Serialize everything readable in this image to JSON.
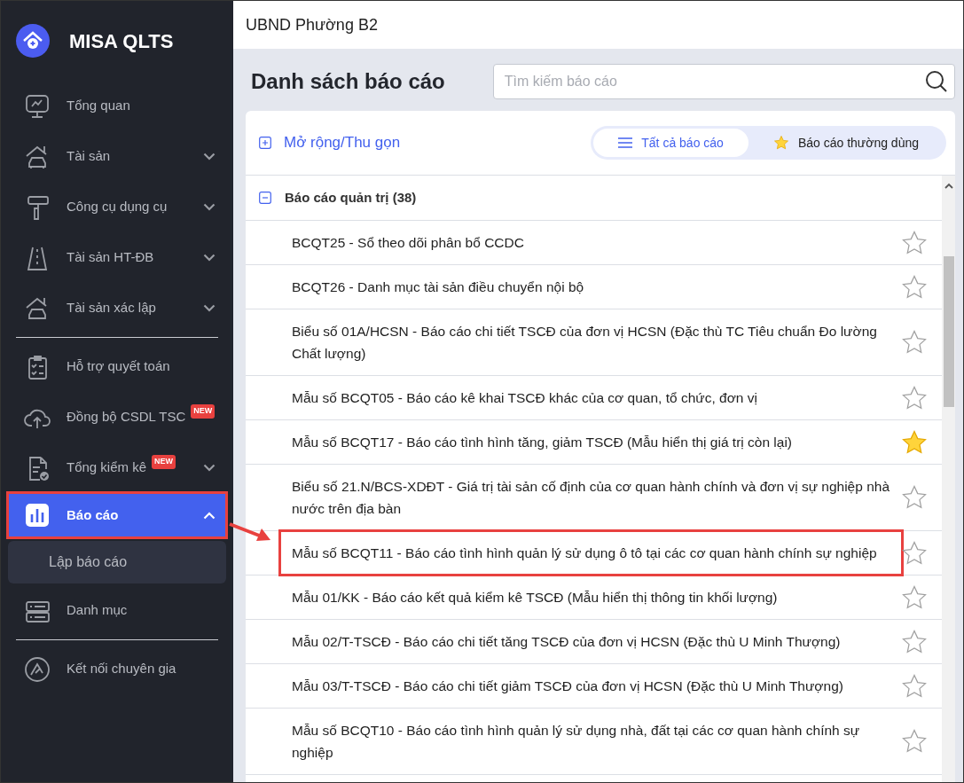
{
  "app": {
    "name": "MISA QLTS"
  },
  "sidebar": {
    "groups": [
      [
        {
          "label": "Tổng quan",
          "selected": false
        },
        {
          "label": "Tài sản",
          "selected": false,
          "expanded": false
        },
        {
          "label": "Công cụ dụng cụ",
          "selected": false,
          "expanded": false
        },
        {
          "label": "Tài sản HT-ĐB",
          "selected": false,
          "expanded": false
        },
        {
          "label": "Tài sản xác lập",
          "selected": false,
          "expanded": false
        }
      ],
      [
        {
          "label": "Hỗ trợ quyết toán",
          "selected": false
        },
        {
          "label": "Đồng bộ CSDL TSC",
          "badge": "NEW",
          "selected": false
        },
        {
          "label": "Tổng kiểm kê",
          "badge": "NEW",
          "selected": false,
          "expanded": false
        },
        {
          "label": "Báo cáo",
          "selected": true,
          "expanded": true,
          "highlighted": true,
          "children": [
            {
              "label": "Lập báo cáo",
              "selected": true
            }
          ]
        },
        {
          "label": "Danh mục",
          "selected": false
        }
      ],
      [
        {
          "label": "Kết nối chuyên gia",
          "selected": false
        }
      ]
    ]
  },
  "header": {
    "title": "UBND Phường B2"
  },
  "page": {
    "title": "Danh sách báo cáo",
    "search": {
      "placeholder": "Tìm kiếm báo cáo"
    }
  },
  "toolbar": {
    "expand_toggle": "Mở rộng/Thu gọn",
    "view_tabs": [
      {
        "label": "Tất cả báo cáo",
        "selected": true
      },
      {
        "label": "Báo cáo thường dùng",
        "selected": false
      }
    ]
  },
  "report_group": {
    "title": "Báo cáo quản trị (38)",
    "expanded": true,
    "reports": [
      {
        "name": "BCQT25 - Sổ theo dõi phân bổ CCDC",
        "favorite": false
      },
      {
        "name": "BCQT26 - Danh mục tài sản điều chuyển nội bộ",
        "favorite": false
      },
      {
        "name": "Biểu số 01A/HCSN - Báo cáo chi tiết TSCĐ của đơn vị HCSN (Đặc thù TC Tiêu chuẩn Đo lường Chất lượng)",
        "favorite": false
      },
      {
        "name": "Mẫu số BCQT05 - Báo cáo kê khai TSCĐ khác của cơ quan, tổ chức, đơn vị",
        "favorite": false
      },
      {
        "name": "Mẫu số BCQT17 - Báo cáo tình hình tăng, giảm TSCĐ (Mẫu hiển thị giá trị còn lại)",
        "favorite": true
      },
      {
        "name": "Biểu số 21.N/BCS-XDĐT - Giá trị tài sản cố định của cơ quan hành chính và đơn vị sự nghiệp nhà nước trên địa bàn",
        "favorite": false
      },
      {
        "name": "Mẫu số BCQT11 - Báo cáo tình hình quản lý sử dụng ô tô tại các cơ quan hành chính sự nghiệp",
        "favorite": false,
        "highlighted": true
      },
      {
        "name": "Mẫu 01/KK - Báo cáo kết quả kiểm kê TSCĐ (Mẫu hiển thị thông tin khối lượng)",
        "favorite": false
      },
      {
        "name": "Mẫu 02/T-TSCĐ - Báo cáo chi tiết tăng TSCĐ của đơn vị HCSN (Đặc thù U Minh Thượng)",
        "favorite": false
      },
      {
        "name": "Mẫu 03/T-TSCĐ - Báo cáo chi tiết giảm TSCĐ của đơn vị HCSN (Đặc thù U Minh Thượng)",
        "favorite": false
      },
      {
        "name": "Mẫu số BCQT10 - Báo cáo tình hình quản lý sử dụng nhà, đất tại các cơ quan hành chính sự nghiệp",
        "favorite": false
      }
    ]
  }
}
